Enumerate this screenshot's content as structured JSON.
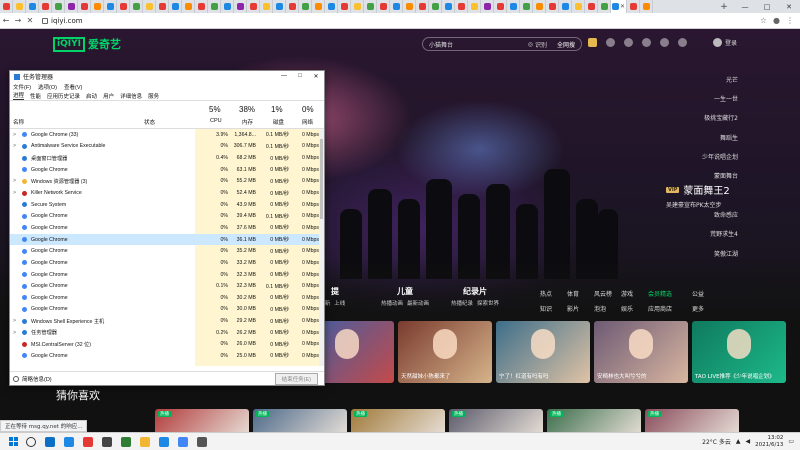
{
  "browser": {
    "url": "iqiyi.com",
    "tab_favicon_colors": [
      "#e53935",
      "#fbc02d",
      "#1e88e5",
      "#e53935",
      "#43a047",
      "#8e24aa",
      "#e53935",
      "#fb8c00",
      "#1e88e5",
      "#e53935",
      "#43a047",
      "#fbc02d",
      "#e53935",
      "#1e88e5",
      "#fb8c00",
      "#e53935",
      "#43a047",
      "#1e88e5",
      "#8e24aa",
      "#e53935",
      "#fbc02d",
      "#1e88e5",
      "#e53935",
      "#43a047",
      "#fb8c00",
      "#1e88e5",
      "#e53935",
      "#fbc02d",
      "#43a047",
      "#e53935",
      "#1e88e5",
      "#fb8c00",
      "#e53935",
      "#43a047",
      "#1e88e5",
      "#e53935",
      "#fbc02d",
      "#8e24aa",
      "#e53935",
      "#1e88e5",
      "#43a047",
      "#fb8c00",
      "#e53935",
      "#1e88e5",
      "#fbc02d",
      "#e53935",
      "#43a047",
      "#1e88e5",
      "#e53935",
      "#fb8c00"
    ],
    "active_tab_index": 47,
    "win_min": "—",
    "win_max": "□",
    "win_close": "✕",
    "newtab": "+",
    "tab_close": "✕"
  },
  "iqiyi": {
    "logo_box": "iQIYI",
    "logo_text": "爱奇艺",
    "search_placeholder": "小猫舞台",
    "search_icon_label": "识别",
    "search_button": "全网搜",
    "login": "登录",
    "side_items": [
      "光芒",
      "一生一世",
      "极挑宝藏行2",
      "舞蹈生",
      "少年说唱企划",
      "蒙面舞台",
      "蒙面舞王2",
      "致命感应",
      "荒野求生4",
      "笑傲江湖"
    ],
    "feature": {
      "vip": "VIP",
      "title": "蒙面舞王2",
      "subtitle": "吴建豪宣布PK太空步"
    },
    "categories": [
      {
        "name": "提",
        "subs": [
          "新",
          "上线"
        ]
      },
      {
        "name": "儿童",
        "subs": [
          "热播动画",
          "最新动画"
        ]
      },
      {
        "name": "纪录片",
        "subs": [
          "热播纪录",
          "探索世界"
        ]
      }
    ],
    "right_cats": [
      "热点",
      "体育",
      "风云榜",
      "游戏",
      "会员精选",
      "公益",
      "知识",
      "影片",
      "泡泡",
      "娱乐",
      "应用商店",
      "更多"
    ],
    "cards": [
      {
        "caption": "",
        "c1": "#3a5fa8",
        "c2": "#c44a4a"
      },
      {
        "caption": "天然甜妹小陈都来了",
        "c1": "#7a3b2f",
        "c2": "#d6b48b"
      },
      {
        "caption": "宁了！杠道有吗有吗",
        "c1": "#3d6e8a",
        "c2": "#e0c3a5"
      },
      {
        "caption": "安畸林也大叫兮兮的",
        "c1": "#6d5a74",
        "c2": "#d8b6a0"
      },
      {
        "caption": "TAO LIVE推荐《少年说唱企划》",
        "c1": "#0f7a5e",
        "c2": "#1db98a"
      }
    ],
    "guess_title": "猜你喜欢",
    "row2_cards": [
      {
        "tag": "热播",
        "c1": "#b23c3c"
      },
      {
        "tag": "热播",
        "c1": "#4d6a8a"
      },
      {
        "tag": "热播",
        "c1": "#a07a3a"
      },
      {
        "tag": "热播",
        "c1": "#5b5b6b"
      },
      {
        "tag": "热播",
        "c1": "#3c6e4c"
      },
      {
        "tag": "热播",
        "c1": "#8a4d5c"
      }
    ],
    "status_hint": "正在等待 msg.qy.net 的响应..."
  },
  "taskmgr": {
    "title": "任务管理器",
    "menu": [
      "文件(F)",
      "选项(O)",
      "查看(V)"
    ],
    "tabs": [
      "进程",
      "性能",
      "应用历史记录",
      "启动",
      "用户",
      "详细信息",
      "服务"
    ],
    "col_name": "名称",
    "col_status": "状态",
    "cpu_pct": "5%",
    "cpu_label": "CPU",
    "mem_pct": "38%",
    "mem_label": "内存",
    "disk_pct": "1%",
    "disk_label": "磁盘",
    "net_pct": "0%",
    "net_label": "网络",
    "rows": [
      {
        "name": "Google Chrome (33)",
        "exp": ">",
        "icon": "#4285f4",
        "cpu": "3.9%",
        "mem": "1,364.8...",
        "disk": "0.1 MB/秒",
        "net": "0 Mbps"
      },
      {
        "name": "Antimalware Service Executable",
        "exp": ">",
        "icon": "#2b7bd6",
        "cpu": "0%",
        "mem": "306.7 MB",
        "disk": "0.1 MB/秒",
        "net": "0 Mbps"
      },
      {
        "name": "桌面窗口管理器",
        "exp": "",
        "icon": "#2b7bd6",
        "cpu": "0.4%",
        "mem": "68.2 MB",
        "disk": "0 MB/秒",
        "net": "0 Mbps"
      },
      {
        "name": "Google Chrome",
        "exp": "",
        "icon": "#4285f4",
        "cpu": "0%",
        "mem": "63.1 MB",
        "disk": "0 MB/秒",
        "net": "0 Mbps"
      },
      {
        "name": "Windows 资源管理器 (3)",
        "exp": ">",
        "icon": "#f2b632",
        "cpu": "0%",
        "mem": "55.2 MB",
        "disk": "0 MB/秒",
        "net": "0 Mbps"
      },
      {
        "name": "Killer Network Service",
        "exp": ">",
        "icon": "#c62828",
        "cpu": "0%",
        "mem": "52.4 MB",
        "disk": "0 MB/秒",
        "net": "0 Mbps"
      },
      {
        "name": "Secure System",
        "exp": "",
        "icon": "#2b7bd6",
        "cpu": "0%",
        "mem": "43.9 MB",
        "disk": "0 MB/秒",
        "net": "0 Mbps"
      },
      {
        "name": "Google Chrome",
        "exp": "",
        "icon": "#4285f4",
        "cpu": "0%",
        "mem": "39.4 MB",
        "disk": "0.1 MB/秒",
        "net": "0 Mbps"
      },
      {
        "name": "Google Chrome",
        "exp": "",
        "icon": "#4285f4",
        "cpu": "0%",
        "mem": "37.6 MB",
        "disk": "0 MB/秒",
        "net": "0 Mbps"
      },
      {
        "name": "Google Chrome",
        "exp": "",
        "icon": "#4285f4",
        "cpu": "0%",
        "mem": "36.1 MB",
        "disk": "0 MB/秒",
        "net": "0 Mbps",
        "sel": true
      },
      {
        "name": "Google Chrome",
        "exp": "",
        "icon": "#4285f4",
        "cpu": "0%",
        "mem": "35.2 MB",
        "disk": "0 MB/秒",
        "net": "0 Mbps"
      },
      {
        "name": "Google Chrome",
        "exp": "",
        "icon": "#4285f4",
        "cpu": "0%",
        "mem": "33.2 MB",
        "disk": "0 MB/秒",
        "net": "0 Mbps"
      },
      {
        "name": "Google Chrome",
        "exp": "",
        "icon": "#4285f4",
        "cpu": "0%",
        "mem": "32.3 MB",
        "disk": "0 MB/秒",
        "net": "0 Mbps"
      },
      {
        "name": "Google Chrome",
        "exp": "",
        "icon": "#4285f4",
        "cpu": "0.1%",
        "mem": "32.3 MB",
        "disk": "0.1 MB/秒",
        "net": "0 Mbps"
      },
      {
        "name": "Google Chrome",
        "exp": "",
        "icon": "#4285f4",
        "cpu": "0%",
        "mem": "30.2 MB",
        "disk": "0 MB/秒",
        "net": "0 Mbps"
      },
      {
        "name": "Google Chrome",
        "exp": "",
        "icon": "#4285f4",
        "cpu": "0%",
        "mem": "30.0 MB",
        "disk": "0 MB/秒",
        "net": "0 Mbps"
      },
      {
        "name": "Windows Shell Experience 主机",
        "exp": ">",
        "icon": "#2b7bd6",
        "cpu": "0%",
        "mem": "29.2 MB",
        "disk": "0 MB/秒",
        "net": "0 Mbps"
      },
      {
        "name": "任务管理器",
        "exp": ">",
        "icon": "#2b7bd6",
        "cpu": "0.2%",
        "mem": "26.2 MB",
        "disk": "0 MB/秒",
        "net": "0 Mbps"
      },
      {
        "name": "MSI.CentralServer (32 位)",
        "exp": "",
        "icon": "#c62828",
        "cpu": "0%",
        "mem": "26.0 MB",
        "disk": "0 MB/秒",
        "net": "0 Mbps"
      },
      {
        "name": "Google Chrome",
        "exp": "",
        "icon": "#4285f4",
        "cpu": "0%",
        "mem": "25.0 MB",
        "disk": "0 MB/秒",
        "net": "0 Mbps"
      }
    ],
    "footer_less": "简略信息(D)",
    "end_task": "结束任务(E)"
  },
  "taskbar": {
    "apps": [
      "#0b6fc6",
      "#1e88e5",
      "#e53935",
      "#444444",
      "#2e7d32",
      "#f2b632",
      "#1e88e5",
      "#4285f4",
      "#555555"
    ],
    "weather": "22°C 多云",
    "time": "13:02",
    "date": "2021/6/13"
  }
}
